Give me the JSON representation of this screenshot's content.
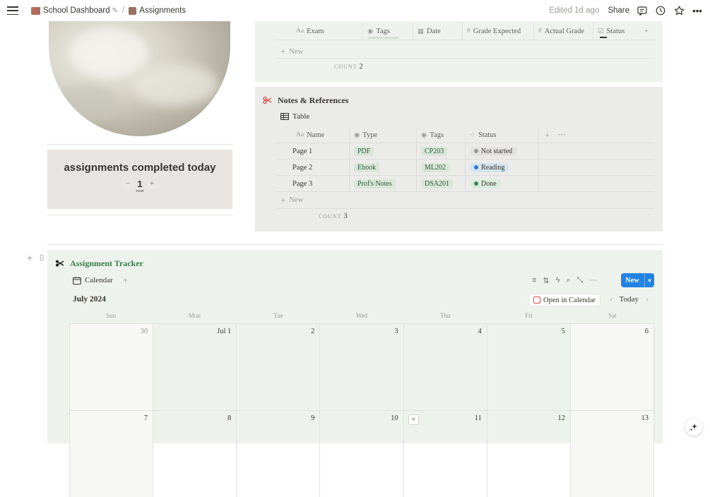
{
  "topbar": {
    "breadcrumb_1": "School Dashboard",
    "breadcrumb_1_suffix": "✎",
    "separator": "/",
    "breadcrumb_2": "Assignments",
    "edited": "Edited 1d ago",
    "share": "Share"
  },
  "counter": {
    "title": "assignments completed today",
    "minus": "−",
    "value": "1",
    "plus": "+",
    "reset": "reset"
  },
  "exam_table": {
    "columns": [
      "Exam",
      "Tags",
      "Date",
      "Grade Expected",
      "Actual Grade",
      "Status"
    ],
    "new_label": "New",
    "count_label": "COUNT",
    "count_value": "2"
  },
  "notes": {
    "title": "Notes & References",
    "view_label": "Table",
    "columns": [
      "Name",
      "Type",
      "Tags",
      "Status"
    ],
    "rows": [
      {
        "name": "Page 1",
        "type": "PDF",
        "tag": "CP203",
        "status": "Not started",
        "status_color": "#9b9a97",
        "status_bg": "#e3e2e0"
      },
      {
        "name": "Page 2",
        "type": "Ebook",
        "tag": "ML202",
        "status": "Reading",
        "status_color": "#2e7cd1",
        "status_bg": "#d3e5ef"
      },
      {
        "name": "Page 3",
        "type": "Prof's Notes",
        "tag": "DSA201",
        "status": "Done",
        "status_color": "#448361",
        "status_bg": "#dbeddb"
      }
    ],
    "new_label": "New",
    "count_label": "COUNT",
    "count_value": "3"
  },
  "tracker": {
    "title": "Assignment Tracker",
    "view_label": "Calendar",
    "new_button": "New",
    "month": "July 2024",
    "open_in_calendar": "Open in Calendar",
    "today": "Today",
    "weekdays": [
      "Sun",
      "Mon",
      "Tue",
      "Wed",
      "Thu",
      "Fri",
      "Sat"
    ],
    "week1": [
      "30",
      "Jul 1",
      "2",
      "3",
      "4",
      "5",
      "6"
    ],
    "week2": [
      "7",
      "8",
      "9",
      "10",
      "11",
      "12",
      "13"
    ]
  },
  "colors": {
    "accent": "#2383e2",
    "panel_green": "#edf3ec",
    "panel_gray": "#ebebea",
    "tracker_title": "#3b7a4f"
  }
}
